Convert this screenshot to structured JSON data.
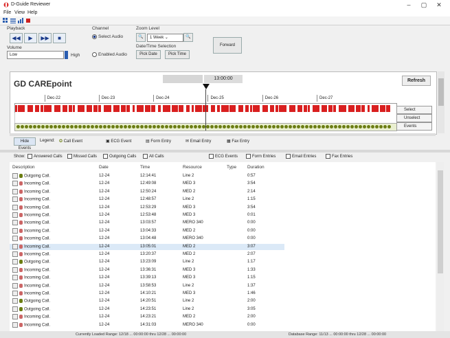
{
  "window": {
    "title": "D-Guide Reviewer",
    "min_glyph": "–",
    "max_glyph": "▢",
    "close_glyph": "✕"
  },
  "menu": [
    "File",
    "View",
    "Help"
  ],
  "controls": {
    "playback_label": "Playback",
    "channel_label": "Channel",
    "channel_options": [
      {
        "label": "Select Audio",
        "selected": true
      },
      {
        "label": "Enabled Audio",
        "selected": false
      }
    ],
    "zoom_label": "Zoom Level",
    "zoom_value": "1 Week",
    "datetime_label": "Date/Time Selection",
    "pick_date": "Pick Date",
    "pick_time": "Pick Time",
    "forward_label": "Forward",
    "volume_label": "Volume",
    "volume_low": "Low",
    "volume_high": "High"
  },
  "timeline": {
    "title": "GD CAREpoint",
    "time": "13:00:00",
    "refresh_label": "Refresh",
    "dates": [
      "Dec-22",
      "Dec-23",
      "Dec-24",
      "Dec-25",
      "Dec-26",
      "Dec-27"
    ],
    "side_labels": [
      "Select",
      "Unselect",
      "Events"
    ]
  },
  "legend": {
    "hide_events": "Hide Events",
    "legend_label": "Legend:",
    "items": [
      "Call Event",
      "ECG Event",
      "Form Entry",
      "Email Entry",
      "Fax Entry"
    ]
  },
  "filters": {
    "show_label": "Show:",
    "items": [
      "Answered Calls",
      "Missed Calls",
      "Outgoing Calls",
      "All Calls",
      "ECG Events",
      "Form Entries",
      "Email Entries",
      "Fax Entries"
    ]
  },
  "table": {
    "columns": [
      "Description",
      "Date",
      "Time",
      "Resource",
      "Type",
      "Duration"
    ],
    "rows": [
      {
        "desc": "Outgoing Call.",
        "date": "12-24",
        "time": "12:14:41",
        "res": "Line 2",
        "type": "",
        "dur": "0:57",
        "kind": "out"
      },
      {
        "desc": "Incoming Call.",
        "date": "12-24",
        "time": "12:49:08",
        "res": "MED 3",
        "type": "",
        "dur": "3:54",
        "kind": "in"
      },
      {
        "desc": "Incoming Call.",
        "date": "12-24",
        "time": "12:50:24",
        "res": "MED 2",
        "type": "",
        "dur": "2:14",
        "kind": "in"
      },
      {
        "desc": "Incoming Call.",
        "date": "12-24",
        "time": "12:48:57",
        "res": "Line 2",
        "type": "",
        "dur": "1:15",
        "kind": "in"
      },
      {
        "desc": "Incoming Call.",
        "date": "12-24",
        "time": "12:53:29",
        "res": "MED 3",
        "type": "",
        "dur": "3:54",
        "kind": "in"
      },
      {
        "desc": "Incoming Call.",
        "date": "12-24",
        "time": "12:53:48",
        "res": "MED 3",
        "type": "",
        "dur": "0:01",
        "kind": "in"
      },
      {
        "desc": "Incoming Call.",
        "date": "12-24",
        "time": "13:03:57",
        "res": "MERO 340",
        "type": "",
        "dur": "0:00",
        "kind": "in"
      },
      {
        "desc": "Incoming Call.",
        "date": "12-24",
        "time": "13:04:33",
        "res": "MED 2",
        "type": "",
        "dur": "0:00",
        "kind": "in"
      },
      {
        "desc": "Incoming Call.",
        "date": "12-24",
        "time": "13:04:48",
        "res": "MERO 340",
        "type": "",
        "dur": "0:00",
        "kind": "in"
      },
      {
        "desc": "Incoming Call.",
        "date": "12-24",
        "time": "13:05:01",
        "res": "MED 2",
        "type": "",
        "dur": "3:07",
        "kind": "in",
        "selected": true
      },
      {
        "desc": "Incoming Call.",
        "date": "12-24",
        "time": "13:20:37",
        "res": "MED 2",
        "type": "",
        "dur": "2:07",
        "kind": "in"
      },
      {
        "desc": "Outgoing Call.",
        "date": "12-24",
        "time": "13:23:09",
        "res": "Line 2",
        "type": "",
        "dur": "1:17",
        "kind": "out"
      },
      {
        "desc": "Incoming Call.",
        "date": "12-24",
        "time": "13:36:31",
        "res": "MED 3",
        "type": "",
        "dur": "1:33",
        "kind": "in"
      },
      {
        "desc": "Incoming Call.",
        "date": "12-24",
        "time": "13:39:13",
        "res": "MED 3",
        "type": "",
        "dur": "1:15",
        "kind": "in"
      },
      {
        "desc": "Incoming Call.",
        "date": "12-24",
        "time": "13:58:53",
        "res": "Line 2",
        "type": "",
        "dur": "1:37",
        "kind": "in"
      },
      {
        "desc": "Incoming Call.",
        "date": "12-24",
        "time": "14:10:21",
        "res": "MED 3",
        "type": "",
        "dur": "1:46",
        "kind": "in"
      },
      {
        "desc": "Outgoing Call.",
        "date": "12-24",
        "time": "14:20:51",
        "res": "Line 2",
        "type": "",
        "dur": "2:00",
        "kind": "out"
      },
      {
        "desc": "Outgoing Call.",
        "date": "12-24",
        "time": "14:23:51",
        "res": "Line 2",
        "type": "",
        "dur": "3:05",
        "kind": "out"
      },
      {
        "desc": "Incoming Call.",
        "date": "12-24",
        "time": "14:23:21",
        "res": "MED 2",
        "type": "",
        "dur": "2:00",
        "kind": "in"
      },
      {
        "desc": "Incoming Call.",
        "date": "12-24",
        "time": "14:31:03",
        "res": "MERO 340",
        "type": "",
        "dur": "0:00",
        "kind": "in"
      }
    ]
  },
  "status": {
    "left": "Currently Loaded Range: 12/18 ... 00:00:00 thru 12/28 ... 00:00:00",
    "right": "Database Range: 11/13 ... 00:00:00 thru 12/28 ... 00:00:00"
  },
  "colors": {
    "event_red": "#d91f1f",
    "event_green": "#6b7d12",
    "selected_row": "#dbe9f7"
  }
}
